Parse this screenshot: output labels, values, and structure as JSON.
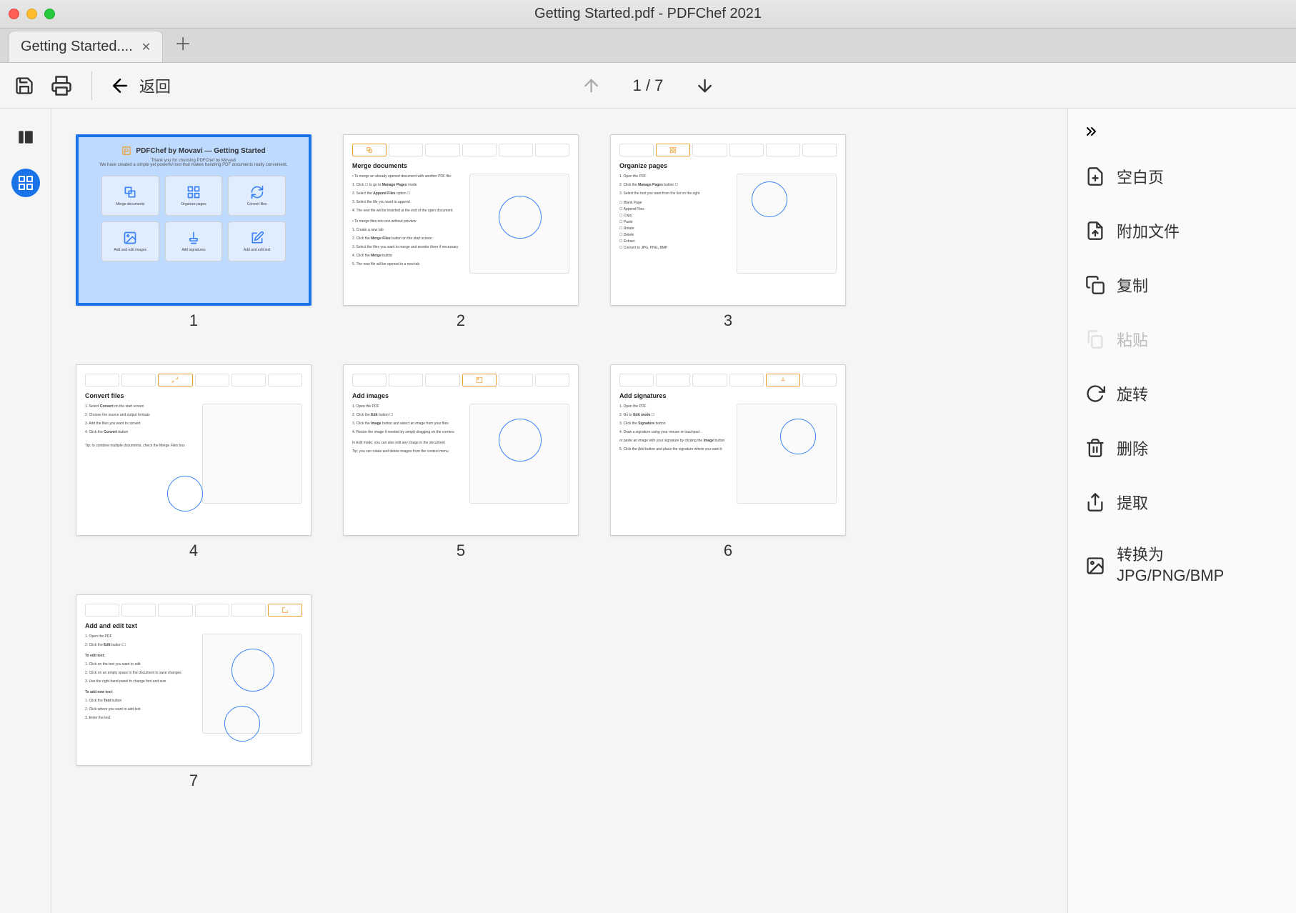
{
  "window": {
    "title": "Getting Started.pdf - PDFChef 2021"
  },
  "tabs": {
    "active_label": "Getting Started...."
  },
  "toolbar": {
    "back_label": "返回",
    "page_indicator": "1 / 7"
  },
  "pages": {
    "count": 7,
    "selected": 1,
    "labels": [
      "1",
      "2",
      "3",
      "4",
      "5",
      "6",
      "7"
    ],
    "p1": {
      "title": "PDFChef by Movavi — Getting Started",
      "subtitle1": "Thank you for choosing PDFChef by Movavi!",
      "subtitle2": "We have created a simple yet powerful tool that makes handling PDF documents really convenient.",
      "cells": [
        "Merge documents",
        "Organize pages",
        "Convert files",
        "Add and edit images",
        "Add signatures",
        "Add and edit text"
      ]
    },
    "p2": {
      "title": "Merge documents"
    },
    "p3": {
      "title": "Organize pages"
    },
    "p4": {
      "title": "Convert files"
    },
    "p5": {
      "title": "Add images"
    },
    "p6": {
      "title": "Add signatures"
    },
    "p7": {
      "title": "Add and edit text"
    }
  },
  "right_panel": {
    "blank_page": "空白页",
    "append_file": "附加文件",
    "copy": "复制",
    "paste": "粘贴",
    "rotate": "旋转",
    "delete": "删除",
    "extract": "提取",
    "convert_line1": "转换为",
    "convert_line2": "JPG/PNG/BMP"
  }
}
